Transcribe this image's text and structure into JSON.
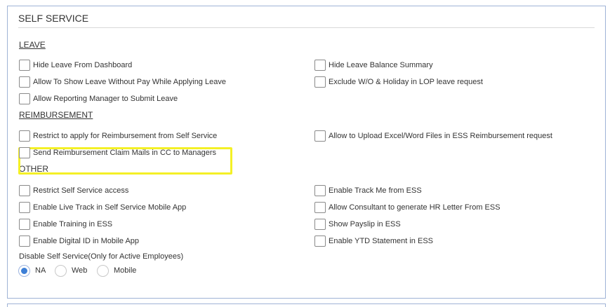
{
  "panel": {
    "title": "SELF SERVICE"
  },
  "leave": {
    "heading": "LEAVE",
    "left": [
      "Hide Leave From Dashboard",
      "Allow To Show Leave Without Pay While Applying Leave",
      "Allow Reporting Manager to Submit Leave"
    ],
    "right": [
      "Hide Leave Balance Summary",
      "Exclude W/O & Holiday in LOP leave request"
    ]
  },
  "reimbursement": {
    "heading": "REIMBURSEMENT",
    "left": [
      "Restrict to apply for Reimbursement from Self Service",
      "Send Reimbursement Claim Mails in CC to Managers"
    ],
    "right": [
      "Allow to Upload Excel/Word Files in ESS Reimbursement request"
    ]
  },
  "other": {
    "heading": "OTHER",
    "left": [
      "Restrict Self Service access",
      "Enable Live Track in Self Service Mobile App",
      "Enable Training in ESS",
      "Enable Digital ID in Mobile App"
    ],
    "right": [
      "Enable Track Me from ESS",
      "Allow Consultant to generate HR Letter From ESS",
      "Show Payslip in ESS",
      "Enable YTD Statement in ESS"
    ]
  },
  "disable_self_service": {
    "label": "Disable Self Service(Only for Active Employees)",
    "options": [
      "NA",
      "Web",
      "Mobile"
    ],
    "selected": "NA"
  },
  "colors": {
    "highlight": "#f4f026",
    "radio_selected": "#3d7fd6",
    "panel_border": "#9fb3d6"
  }
}
